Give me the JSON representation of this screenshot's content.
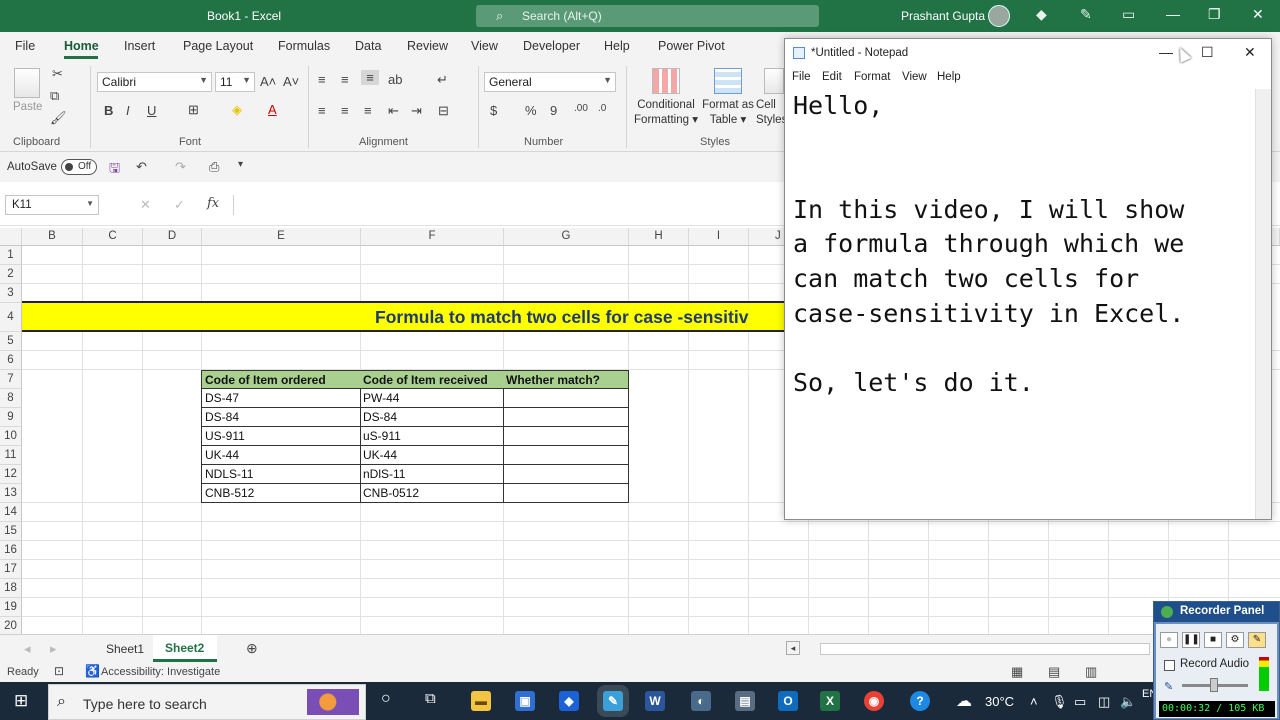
{
  "excel": {
    "title": "Book1  -  Excel",
    "search_placeholder": "Search (Alt+Q)",
    "user": "Prashant Gupta",
    "tabs": [
      "File",
      "Home",
      "Insert",
      "Page Layout",
      "Formulas",
      "Data",
      "Review",
      "View",
      "Developer",
      "Help",
      "Power Pivot"
    ],
    "ribbon": {
      "paste": "Paste",
      "font_name": "Calibri",
      "font_size": "11",
      "number_format": "General",
      "conditional_formatting": [
        "Conditional",
        "Formatting"
      ],
      "format_as_table": [
        "Format as",
        "Table"
      ],
      "cell_styles": [
        "Cell",
        "Styles"
      ],
      "groups": [
        "Clipboard",
        "Font",
        "Alignment",
        "Number",
        "Styles"
      ]
    },
    "qat": {
      "autosave": "AutoSave",
      "toggle": "Off"
    },
    "namebox": "K11",
    "fx": "fx",
    "columns": [
      "B",
      "C",
      "D",
      "E",
      "F",
      "G",
      "H",
      "I",
      "J"
    ],
    "rows": [
      "1",
      "2",
      "3",
      "4",
      "5",
      "6",
      "7",
      "8",
      "9",
      "10",
      "11",
      "12",
      "13",
      "14",
      "15",
      "16",
      "17",
      "18",
      "19",
      "20"
    ],
    "banner": "Formula to match two cells for case -sensitiv",
    "table": {
      "headers": [
        "Code of Item ordered",
        "Code of Item received",
        "Whether match?"
      ],
      "rows": [
        [
          "DS-47",
          "PW-44",
          ""
        ],
        [
          "DS-84",
          "DS-84",
          ""
        ],
        [
          "US-911",
          "uS-911",
          ""
        ],
        [
          "UK-44",
          "UK-44",
          ""
        ],
        [
          "NDLS-11",
          "nDlS-11",
          ""
        ],
        [
          "CNB-512",
          "CNB-0512",
          ""
        ]
      ]
    },
    "sheets": [
      "Sheet1",
      "Sheet2"
    ],
    "status": {
      "ready": "Ready",
      "accessibility": "Accessibility: Investigate"
    }
  },
  "notepad": {
    "title": "*Untitled - Notepad",
    "menu": [
      "File",
      "Edit",
      "Format",
      "View",
      "Help"
    ],
    "text": "Hello,\n\n\nIn this video, I will show\na formula through which we\ncan match two cells for\ncase-sensitivity in Excel.\n\nSo, let's do it."
  },
  "taskbar": {
    "search_placeholder": "Type here to search",
    "temperature": "30°C",
    "lang": "EN"
  },
  "recorder": {
    "title": "Recorder Panel",
    "record_audio": "Record Audio",
    "status": "00:00:32 / 105 KB"
  },
  "colors": {
    "excel_green": "#217346",
    "banner_yellow": "#ffff00",
    "header_green": "#a9d08e",
    "taskbar": "#1b2a3a"
  }
}
